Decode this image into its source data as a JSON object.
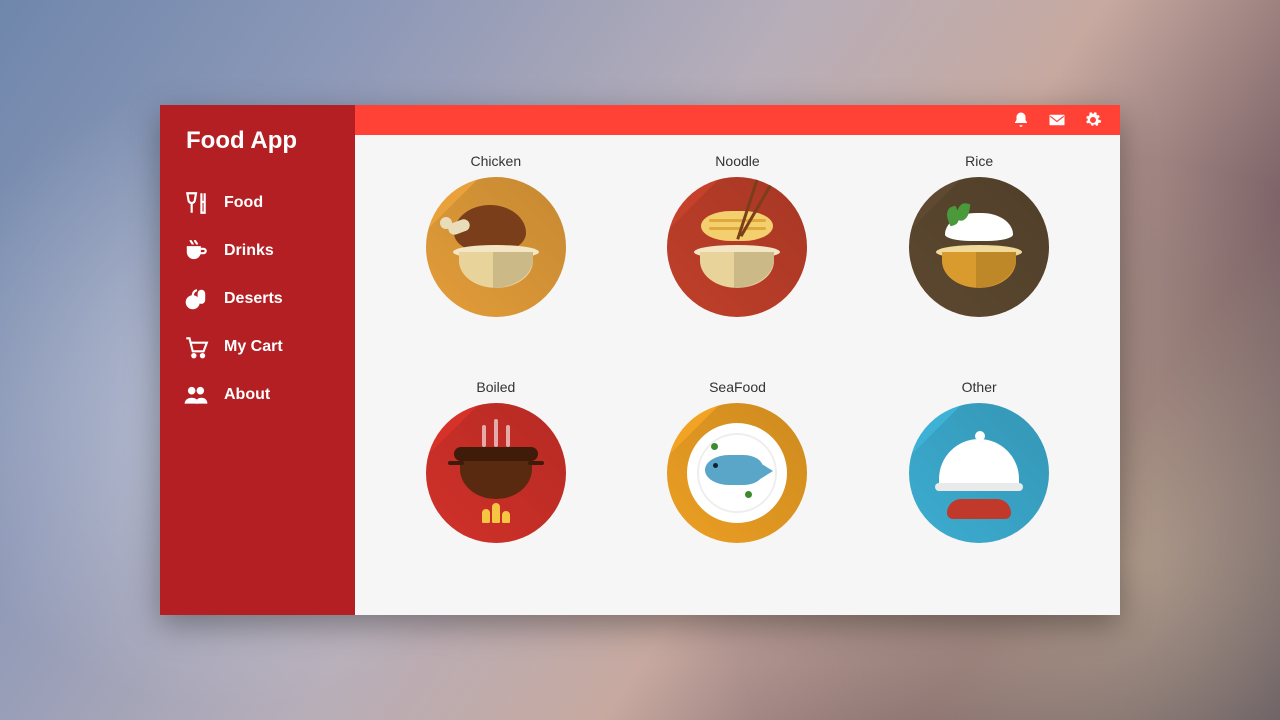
{
  "app": {
    "title": "Food App"
  },
  "sidebar": {
    "items": [
      {
        "label": "Food",
        "icon": "glass-fork-icon"
      },
      {
        "label": "Drinks",
        "icon": "cup-icon"
      },
      {
        "label": "Deserts",
        "icon": "fruit-icon"
      },
      {
        "label": "My Cart",
        "icon": "cart-icon"
      },
      {
        "label": "About",
        "icon": "people-icon"
      }
    ]
  },
  "topbar": {
    "icons": [
      "bell-icon",
      "mail-icon",
      "gear-icon"
    ]
  },
  "categories": [
    {
      "label": "Chicken",
      "style": "chicken"
    },
    {
      "label": "Noodle",
      "style": "noodle"
    },
    {
      "label": "Rice",
      "style": "rice"
    },
    {
      "label": "Boiled",
      "style": "boiled"
    },
    {
      "label": "SeaFood",
      "style": "seafood"
    },
    {
      "label": "Other",
      "style": "other"
    }
  ],
  "colors": {
    "sidebar": "#b41f24",
    "topbar": "#ff4136",
    "content": "#f6f6f6"
  }
}
